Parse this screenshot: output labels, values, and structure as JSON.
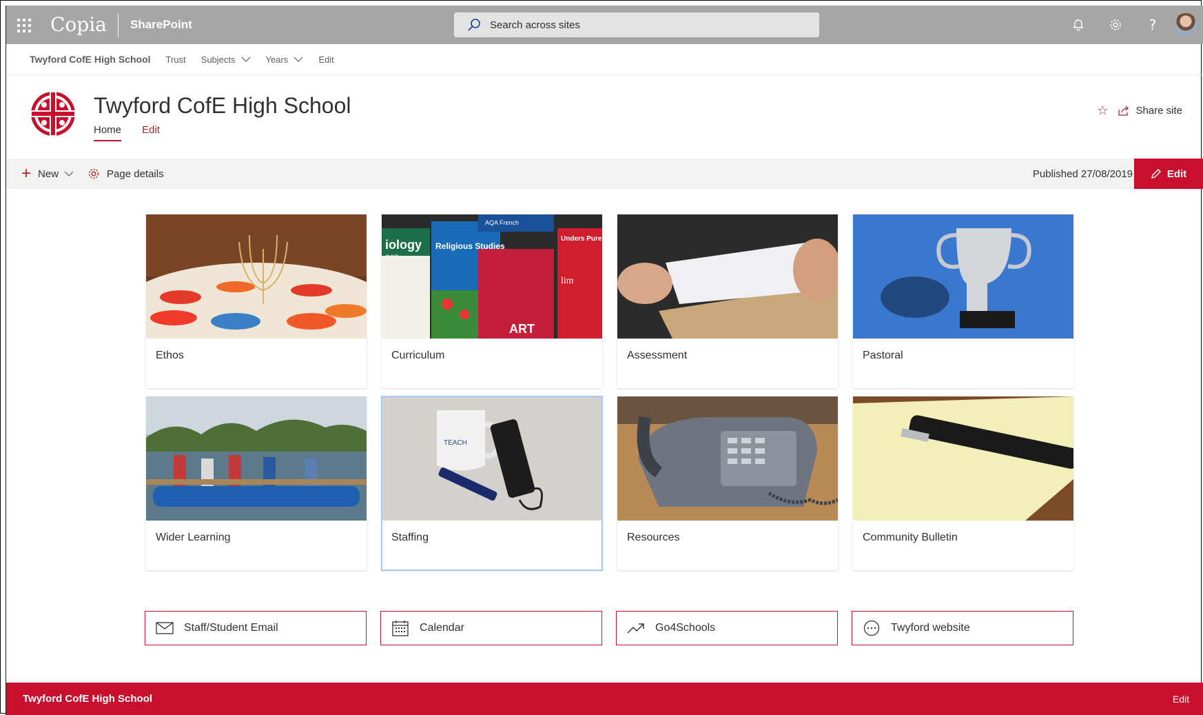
{
  "suite_bar": {
    "brand": "Copia",
    "product": "SharePoint",
    "search_placeholder": "Search across sites",
    "icons": [
      "waffle-icon",
      "bell-icon",
      "gear-icon",
      "help-icon",
      "avatar"
    ]
  },
  "hub_nav": {
    "home": "Twyford CofE High School",
    "items": [
      {
        "label": "Trust"
      },
      {
        "label": "Subjects",
        "dropdown": true
      },
      {
        "label": "Years",
        "dropdown": true
      },
      {
        "label": "Edit"
      }
    ]
  },
  "site_header": {
    "title": "Twyford CofE High School",
    "tabs": [
      {
        "label": "Home"
      },
      {
        "label": "Edit"
      }
    ],
    "share_label": "Share site"
  },
  "command_bar": {
    "new_label": "New",
    "page_details_label": "Page details",
    "published": "Published 27/08/2019",
    "edit_label": "Edit"
  },
  "tiles": [
    {
      "label": "Ethos"
    },
    {
      "label": "Curriculum"
    },
    {
      "label": "Assessment"
    },
    {
      "label": "Pastoral"
    },
    {
      "label": "Wider Learning"
    },
    {
      "label": "Staffing",
      "selected": true
    },
    {
      "label": "Resources"
    },
    {
      "label": "Community Bulletin"
    }
  ],
  "tile_images": {
    "curriculum_book_texts": [
      "AQA French",
      "iology",
      "OCR",
      "Religious Studies",
      "Unders Pure Mather",
      "ART",
      "lim"
    ],
    "staffing_mug_text": "TEACH"
  },
  "quick_links": [
    {
      "label": "Staff/Student Email",
      "icon": "mail-icon"
    },
    {
      "label": "Calendar",
      "icon": "calendar-icon"
    },
    {
      "label": "Go4Schools",
      "icon": "trending-icon"
    },
    {
      "label": "Twyford website",
      "icon": "globe-icon"
    }
  ],
  "footer": {
    "name": "Twyford CofE High School",
    "edit_label": "Edit"
  },
  "colors": {
    "accent": "#c8102e",
    "suite_bar": "#a6a6a6",
    "command_bar": "#f3f2f1"
  }
}
